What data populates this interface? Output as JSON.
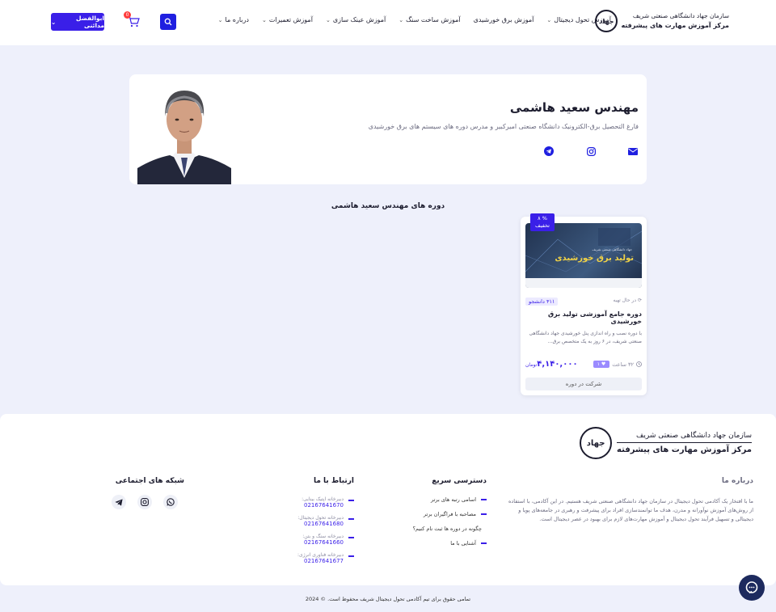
{
  "header": {
    "logo": {
      "line1": "سازمان جهاد دانشگاهی صنعتی شریف",
      "line2": "مرکز آموزش مهارت های پیشرفته",
      "seal_text": "جهاد"
    },
    "nav": [
      {
        "label": "آموزش تحول دیجیتال",
        "dropdown": true
      },
      {
        "label": "آموزش برق خورشیدی",
        "dropdown": false
      },
      {
        "label": "آموزش ساخت سنگ",
        "dropdown": true
      },
      {
        "label": "آموزش عینک سازی",
        "dropdown": true
      },
      {
        "label": "آموزش تعمیرات",
        "dropdown": true
      },
      {
        "label": "درباره ما",
        "dropdown": true
      }
    ],
    "cart_count": "0",
    "user_label": "ابوالفضل مدائنی"
  },
  "profile": {
    "name": "مهندس سعید هاشمی",
    "bio": "فارغ التحصیل برق-الکترونیک دانشگاه صنعتی امیرکبیر و مدرس دوره های سیستم های برق خورشیدی",
    "socials": [
      "email-icon",
      "instagram-icon",
      "telegram-icon"
    ]
  },
  "section_title": "دوره های مهندس سعید هاشمی",
  "course": {
    "discount": "% ۸",
    "discount_label": "تخفیف",
    "thumb_title": "تولید برق خورشیدی",
    "thumb_sub": "جهاد دانشگاهی صنعتی شریف",
    "status": "در حال تهیه",
    "students": "۴۱۱ دانشجو",
    "title": "دوره جامع آموزشی تولید برق خورشیدی",
    "desc": "با دوره نصب و راه اندازی پنل خورشیدی جهاد دانشگاهی صنعتی شریف، در ۶ روز به یک متخصص برق...",
    "hours": "۳۲ ساعت",
    "likes": "۱",
    "price": "۴,۱۴۰,۰۰۰",
    "currency": "تومان",
    "enroll_label": "شرکت در دوره"
  },
  "footer": {
    "logo": {
      "line1": "سازمان جهاد دانشگاهی صنعتی شریف",
      "line2": "مرکز آموزش مهارت های پیشرفته",
      "seal_text": "جهاد"
    },
    "about": {
      "title": "درباره ما",
      "text": "ما با افتخار یک آکادمی تحول دیجیتال در سازمان جهاد دانشگاهی صنعتی شریف هستیم. در این آکادمی، با استفاده از روش‌های آموزش نوآورانه و مدرن، هدف ما توانمندسازی افراد برای پیشرفت و رهبری در جامعه‌های پویا و دیجیتالی و تسهیل فرآیند تحول دیجیتال و آموزش مهارت‌های لازم برای بهبود در عصر دیجیتال است."
    },
    "quick": {
      "title": "دسترسی سریع",
      "items": [
        "اسامی رتبه های برتر",
        "مصاحبه با فراگیران برتر",
        "چگونه در دوره ها ثبت نام کنیم؟",
        "آشنایی با ما"
      ]
    },
    "contact": {
      "title": "ارتباط با ما",
      "items": [
        {
          "label": "دبیرخانه اپتیک بینایی:",
          "phone": "02167641670"
        },
        {
          "label": "دبیرخانه تحول دیجیتال:",
          "phone": "02167641680"
        },
        {
          "label": "دبیرخانه سنگ و بتن:",
          "phone": "02167641660"
        },
        {
          "label": "دبیرخانه فناوری انرژی:",
          "phone": "02167641677"
        }
      ]
    },
    "social": {
      "title": "شبکه های اجتماعی",
      "icons": [
        "whatsapp-icon",
        "instagram-icon",
        "telegram-icon"
      ]
    },
    "copyright": "تمامی حقوق برای تیم آکادمی تحول دیجیتال شریف محفوظ است. © 2024"
  },
  "colors": {
    "primary": "#3a1fe8",
    "search": "#1f1fe0",
    "background": "#eef0fb",
    "chat": "#1d2a5e"
  }
}
